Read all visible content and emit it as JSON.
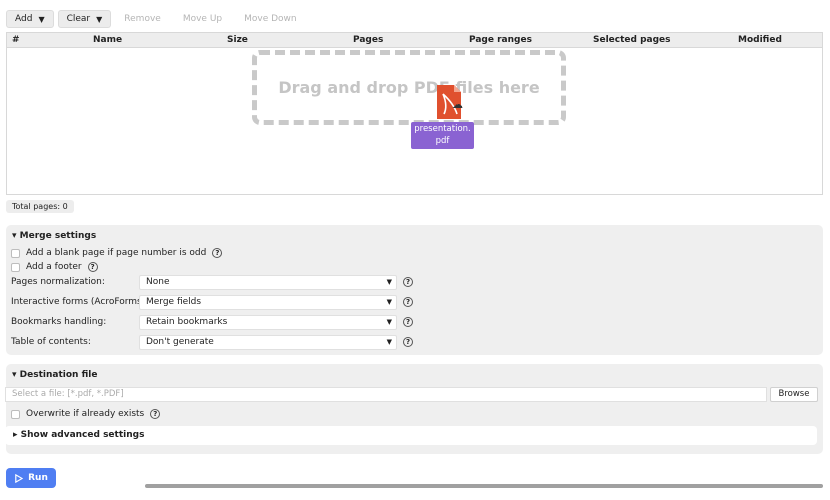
{
  "toolbar": {
    "add_label": "Add",
    "clear_label": "Clear",
    "remove_label": "Remove",
    "move_up_label": "Move Up",
    "move_down_label": "Move Down"
  },
  "table": {
    "columns": [
      "#",
      "Name",
      "Size",
      "Pages",
      "Page ranges",
      "Selected pages",
      "Modified"
    ]
  },
  "dropzone": {
    "text": "Drag and drop PDF files here",
    "dragged_file_line1": "presentation.",
    "dragged_file_line2": "pdf"
  },
  "status": {
    "total_pages": "Total pages: 0"
  },
  "merge_settings": {
    "title": "Merge settings",
    "blank_page_label": "Add a blank page if page number is odd",
    "footer_label": "Add a footer",
    "pages_normalization_label": "Pages normalization:",
    "pages_normalization_value": "None",
    "forms_label": "Interactive forms (AcroForms):",
    "forms_value": "Merge fields",
    "bookmarks_label": "Bookmarks handling:",
    "bookmarks_value": "Retain bookmarks",
    "toc_label": "Table of contents:",
    "toc_value": "Don't generate"
  },
  "destination": {
    "title": "Destination file",
    "file_placeholder": "Select a file: [*.pdf, *.PDF]",
    "browse_label": "Browse",
    "overwrite_label": "Overwrite if already exists",
    "advanced_label": "Show advanced settings"
  },
  "run_label": "Run",
  "colors": {
    "accent": "#4f7ef2",
    "drag_label_bg": "#8a63d2",
    "pdf_icon": "#e0502e"
  }
}
